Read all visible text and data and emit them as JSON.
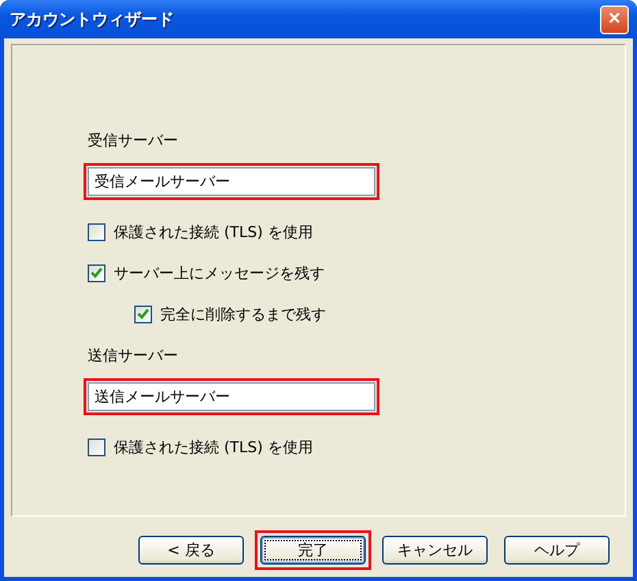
{
  "window": {
    "title": "アカウントウィザード",
    "close": "×"
  },
  "sections": [
    {
      "label": "受信サーバー",
      "field": {
        "value": "受信メールサーバー",
        "highlighted": true
      },
      "options": [
        {
          "label": "保護された接続 (TLS) を使用",
          "checked": false
        },
        {
          "label": "サーバー上にメッセージを残す",
          "checked": true,
          "children": [
            {
              "label": "完全に削除するまで残す",
              "checked": true
            }
          ]
        }
      ]
    },
    {
      "label": "送信サーバー",
      "field": {
        "value": "送信メールサーバー",
        "highlighted": true
      },
      "options": [
        {
          "label": "保護された接続 (TLS) を使用",
          "checked": false
        }
      ]
    }
  ],
  "buttons": [
    {
      "label": "< 戻る",
      "highlighted": false,
      "default": false
    },
    {
      "label": "完了",
      "highlighted": true,
      "default": true
    },
    {
      "label": "キャンセル",
      "highlighted": false,
      "default": false
    },
    {
      "label": "ヘルプ",
      "highlighted": false,
      "default": false
    }
  ]
}
